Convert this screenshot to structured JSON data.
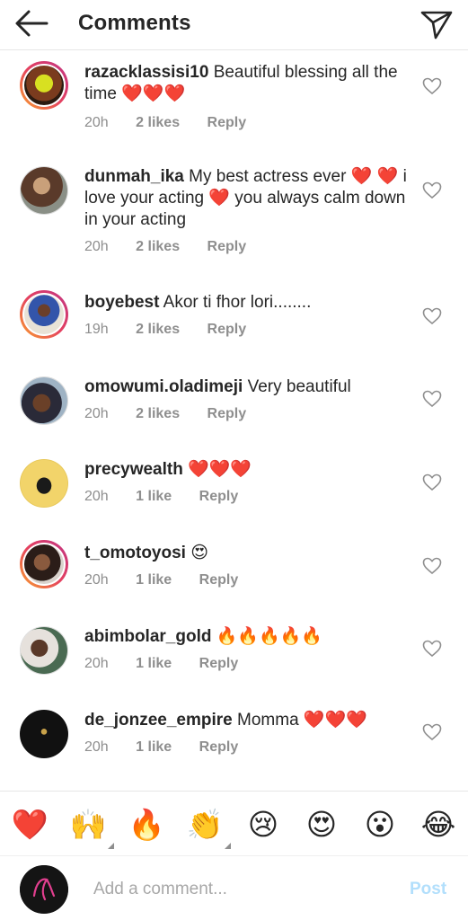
{
  "header": {
    "title": "Comments",
    "back_icon": "back-arrow-icon",
    "send_icon": "send-icon"
  },
  "comments": [
    {
      "username": "razacklassisi10",
      "text": "Beautiful blessing all the time ❤️❤️❤️",
      "time": "20h",
      "likes": "2 likes",
      "reply": "Reply",
      "story_ring": true
    },
    {
      "username": "dunmah_ika",
      "text": "My best actress ever ❤️ ❤️ i love your acting ❤️ you always calm down in your acting",
      "time": "20h",
      "likes": "2 likes",
      "reply": "Reply",
      "story_ring": false
    },
    {
      "username": "boyebest",
      "text": "Akor ti fhor lori........",
      "time": "19h",
      "likes": "2 likes",
      "reply": "Reply",
      "story_ring": true
    },
    {
      "username": "omowumi.oladimeji",
      "text": "Very beautiful",
      "time": "20h",
      "likes": "2 likes",
      "reply": "Reply",
      "story_ring": false
    },
    {
      "username": "precywealth",
      "text": "❤️❤️❤️",
      "time": "20h",
      "likes": "1 like",
      "reply": "Reply",
      "story_ring": false
    },
    {
      "username": "t_omotoyosi",
      "text": "😍",
      "time": "20h",
      "likes": "1 like",
      "reply": "Reply",
      "story_ring": true
    },
    {
      "username": "abimbolar_gold",
      "text": "🔥🔥🔥🔥🔥",
      "time": "20h",
      "likes": "1 like",
      "reply": "Reply",
      "story_ring": false
    },
    {
      "username": "de_jonzee_empire",
      "text": "Momma ❤️❤️❤️",
      "time": "20h",
      "likes": "1 like",
      "reply": "Reply",
      "story_ring": false
    }
  ],
  "reactions": [
    "❤️",
    "🙌",
    "🔥",
    "👏",
    "😢",
    "😍",
    "😮",
    "😂"
  ],
  "composer": {
    "placeholder": "Add a comment...",
    "post_label": "Post"
  },
  "colors": {
    "story_ring": [
      "#f9a12e",
      "#e4405f",
      "#c13584"
    ],
    "post_inactive": "#b2dffc",
    "meta_gray": "#8e8e8e"
  }
}
